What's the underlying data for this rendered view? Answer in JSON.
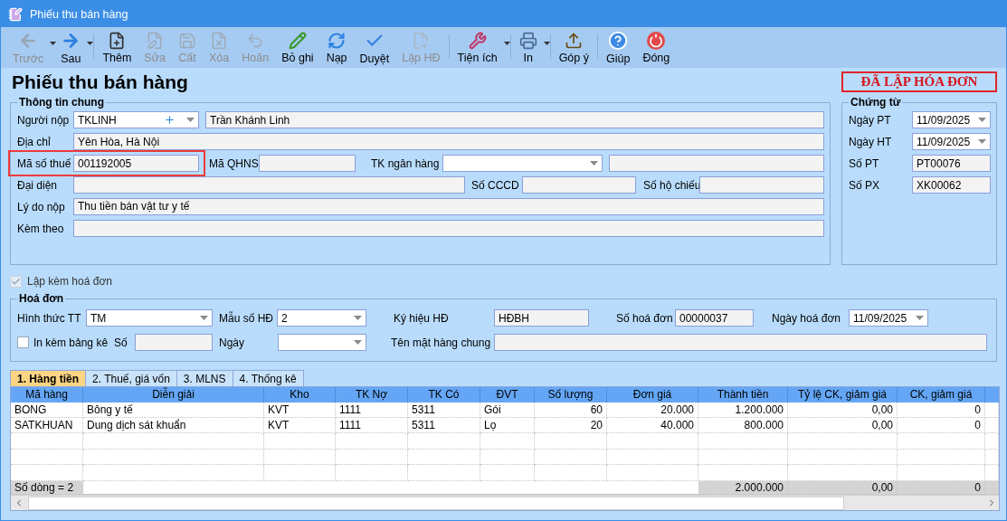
{
  "window": {
    "title": "Phiếu thu bán hàng"
  },
  "toolbar": [
    {
      "label": "Trước",
      "kind": "back",
      "disabled": true,
      "dropdown": true,
      "separator_before": false
    },
    {
      "label": "Sau",
      "kind": "forward",
      "disabled": false,
      "dropdown": true,
      "separator_before": false
    },
    {
      "label": "Thêm",
      "kind": "new",
      "disabled": false,
      "dropdown": false,
      "separator_before": true
    },
    {
      "label": "Sửa",
      "kind": "edit",
      "disabled": true,
      "dropdown": false,
      "separator_before": false
    },
    {
      "label": "Cất",
      "kind": "save",
      "disabled": true,
      "dropdown": false,
      "separator_before": false
    },
    {
      "label": "Xóa",
      "kind": "delete",
      "disabled": true,
      "dropdown": false,
      "separator_before": false
    },
    {
      "label": "Hoãn",
      "kind": "undo",
      "disabled": true,
      "dropdown": false,
      "separator_before": false
    },
    {
      "label": "Bỏ ghi",
      "kind": "unpost",
      "disabled": false,
      "dropdown": false,
      "separator_before": false
    },
    {
      "label": "Nạp",
      "kind": "reload",
      "disabled": false,
      "dropdown": false,
      "separator_before": false
    },
    {
      "label": "Duyệt",
      "kind": "approve",
      "disabled": false,
      "dropdown": false,
      "separator_before": false
    },
    {
      "label": "Lập HĐ",
      "kind": "invoice",
      "disabled": true,
      "dropdown": false,
      "separator_before": false
    },
    {
      "label": "Tiện ích",
      "kind": "tools",
      "disabled": false,
      "dropdown": true,
      "separator_before": true
    },
    {
      "label": "In",
      "kind": "print",
      "disabled": false,
      "dropdown": true,
      "separator_before": true
    },
    {
      "label": "Góp ý",
      "kind": "feedback",
      "disabled": false,
      "dropdown": false,
      "separator_before": true
    },
    {
      "label": "Giúp",
      "kind": "help",
      "disabled": false,
      "dropdown": false,
      "separator_before": true
    },
    {
      "label": "Đóng",
      "kind": "close",
      "disabled": false,
      "dropdown": false,
      "separator_before": false
    }
  ],
  "heading": "Phiếu thu bán hàng",
  "status_badge": "ĐÃ LẬP HÓA ĐƠN",
  "general_info": {
    "title": "Thông tin chung",
    "payer": {
      "label": "Người nộp",
      "code": "TKLINH",
      "name": "Trần Khánh Linh"
    },
    "address": {
      "label": "Địa chỉ",
      "value": "Yên Hòa, Hà Nội"
    },
    "tax_code": {
      "label": "Mã số thuế",
      "value": "001192005",
      "highlighted": true
    },
    "budget_code": {
      "label": "Mã QHNS"
    },
    "bank_account": {
      "label": "TK ngân hàng"
    },
    "representative": {
      "label": "Đại diện"
    },
    "id_card": {
      "label": "Số CCCD"
    },
    "passport": {
      "label": "Số hộ chiếu"
    },
    "reason": {
      "label": "Lý do nộp",
      "value": "Thu tiền bán vật tư y tế"
    },
    "attachments": {
      "label": "Kèm theo"
    }
  },
  "voucher": {
    "title": "Chứng từ",
    "fields": [
      {
        "label": "Ngày PT",
        "value": "11/09/2025",
        "kind": "date"
      },
      {
        "label": "Ngày HT",
        "value": "11/09/2025",
        "kind": "date"
      },
      {
        "label": "Số PT",
        "value": "PT00076",
        "kind": "text"
      },
      {
        "label": "Số PX",
        "value": "XK00062",
        "kind": "text"
      }
    ]
  },
  "attach_invoice": {
    "label": "Lập kèm hoá đơn",
    "checked": true,
    "disabled": true
  },
  "invoice": {
    "title": "Hoá đơn",
    "payment_method": {
      "label": "Hình thức TT",
      "value": "TM"
    },
    "template": {
      "label": "Mẫu số HĐ",
      "value": "2"
    },
    "symbol": {
      "label": "Ký hiệu HĐ",
      "value": "HĐBH"
    },
    "number": {
      "label": "Số hoá đơn",
      "value": "00000037"
    },
    "date": {
      "label": "Ngày hoá đơn",
      "value": "11/09/2025"
    },
    "print_list": {
      "label": "In kèm bảng kê",
      "checked": false
    },
    "list_number": {
      "label": "Số"
    },
    "list_date": {
      "label": "Ngày"
    },
    "item_name": {
      "label": "Tên mặt hàng chung"
    }
  },
  "tabs": [
    {
      "label": "1. Hàng tiền",
      "selected": true
    },
    {
      "label": "2. Thuế, giá vốn",
      "selected": false
    },
    {
      "label": "3. MLNS",
      "selected": false
    },
    {
      "label": "4. Thống kê",
      "selected": false
    }
  ],
  "table": {
    "columns": [
      "Mã hàng",
      "Diễn giải",
      "Kho",
      "TK Nợ",
      "TK Có",
      "ĐVT",
      "Số lượng",
      "Đơn giá",
      "Thành tiền",
      "Tỷ lệ CK, giảm giá",
      "CK, giảm giá"
    ],
    "rows": [
      [
        "BONG",
        "Bông y tế",
        "KVT",
        "1111",
        "5311",
        "Gói",
        "60",
        "20.000",
        "1.200.000",
        "0,00",
        "0"
      ],
      [
        "SATKHUAN",
        "Dung dịch sát khuẩn",
        "KVT",
        "1111",
        "5311",
        "Lọ",
        "20",
        "40.000",
        "800.000",
        "0,00",
        "0"
      ]
    ],
    "footer": {
      "row_count": "Số dòng = 2",
      "totals": [
        "2.000.000",
        "0,00",
        "0"
      ]
    }
  }
}
